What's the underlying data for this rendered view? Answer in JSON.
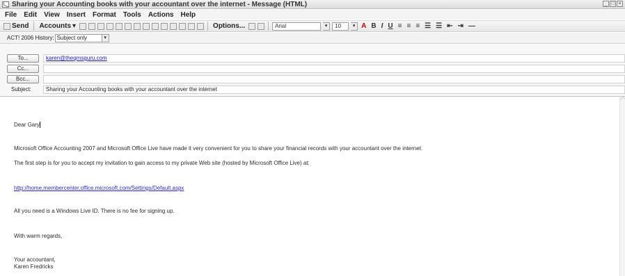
{
  "window": {
    "title": "Sharing your Accounting books with your accountant over the internet - Message (HTML)"
  },
  "menu": [
    "File",
    "Edit",
    "View",
    "Insert",
    "Format",
    "Tools",
    "Actions",
    "Help"
  ],
  "toolbar": {
    "send_label": "Send",
    "accounts_label": "Accounts",
    "options_label": "Options...",
    "font_name": "Arial",
    "font_size": "10"
  },
  "history": {
    "label": "ACT! 2006 History:",
    "value": "Subject only"
  },
  "headers": {
    "to_button": "To...",
    "cc_button": "Cc...",
    "bcc_button": "Bcc...",
    "subject_label": "Subject:",
    "to_value": "karen@theqmsguru.com",
    "cc_value": "",
    "bcc_value": "",
    "subject_value": "Sharing your Accounting books with your accountant over the internet"
  },
  "body": {
    "greeting": "Dear Gary",
    "para1": "Microsoft Office Accounting 2007 and Microsoft Office Live have made it very convenient for you to share your financial records with your accountant over the internet.",
    "para2": "The first step is for you to accept my invitation to gain access to my private Web site (hosted by Microsoft Office Live) at:",
    "link": "http://home.membercenter.office.microsoft.com/Settings/Default.aspx",
    "para3": "All you need is a Windows Live ID. There is no fee for signing up.",
    "closing": "With warm regards,",
    "sign1": "Your accountant,",
    "sign2": "Karen Fredricks"
  }
}
